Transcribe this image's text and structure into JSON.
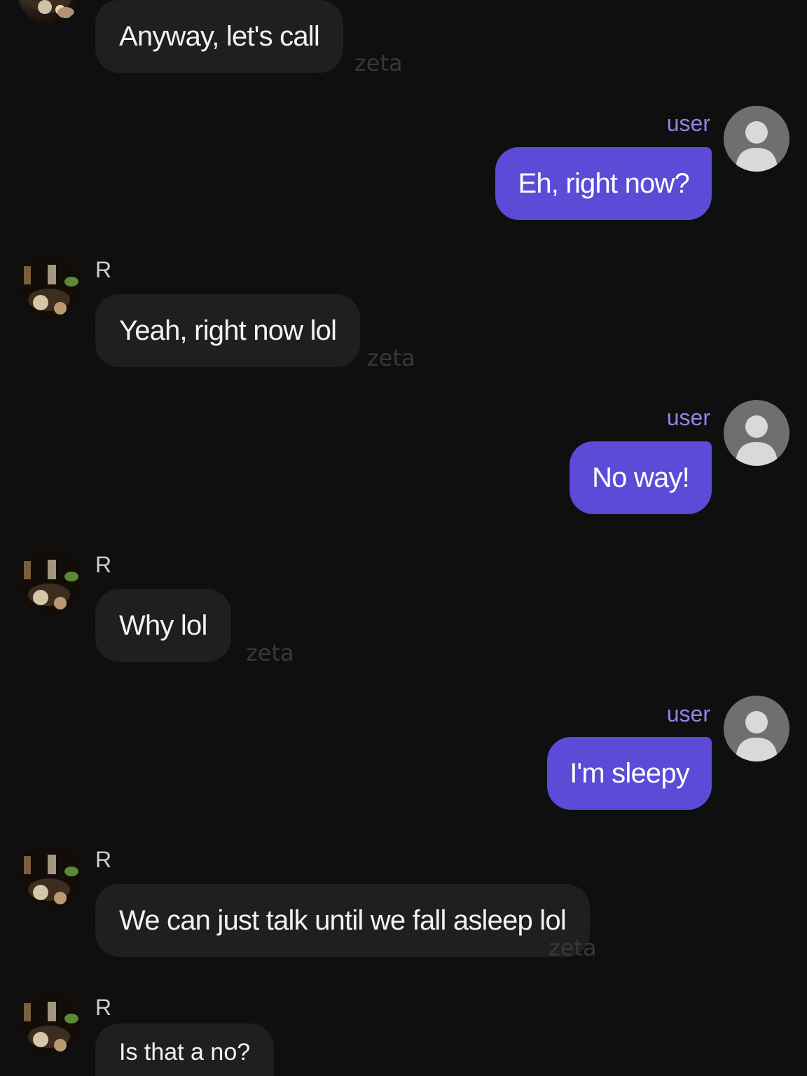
{
  "messages": [
    {
      "sender": "",
      "text": "Anyway, let's call",
      "watermark": "zeta"
    },
    {
      "sender": "user",
      "text": "Eh, right now?"
    },
    {
      "sender": "R",
      "text": "Yeah, right now lol",
      "watermark": "zeta"
    },
    {
      "sender": "user",
      "text": "No way!"
    },
    {
      "sender": "R",
      "text": "Why lol",
      "watermark": "zeta"
    },
    {
      "sender": "user",
      "text": "I'm sleepy"
    },
    {
      "sender": "R",
      "text": "We can just talk until we fall asleep lol",
      "watermark": "zeta"
    },
    {
      "sender": "R",
      "text": "Is that a no?"
    }
  ],
  "colors": {
    "background": "#0f0f10",
    "bot_bubble": "#1f1f21",
    "user_bubble": "#5b4bd6",
    "user_label": "#8f86e8",
    "watermark": "#38383b"
  },
  "icons": {
    "bot_avatar": "photo-avatar-icon",
    "user_avatar": "default-user-avatar-icon"
  }
}
